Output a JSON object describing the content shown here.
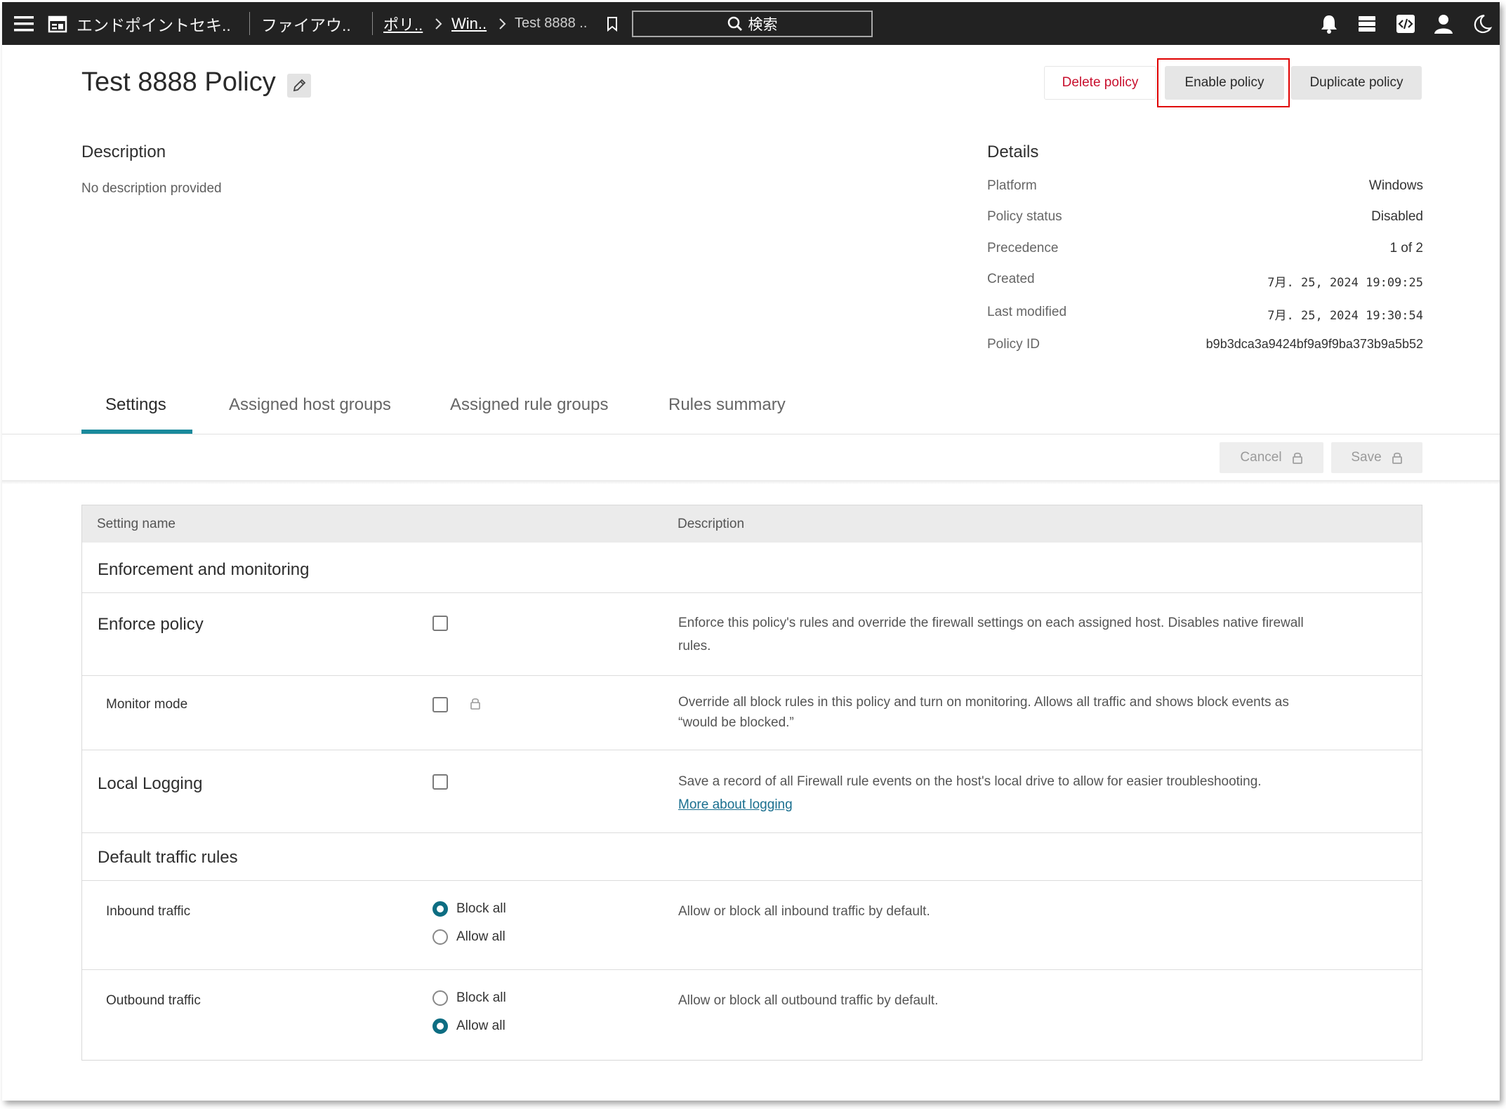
{
  "topbar": {
    "app_title": "エンドポイントセキ..",
    "section": "ファイアウ..",
    "breadcrumb_1": "ポリ..",
    "breadcrumb_2": "Win..",
    "breadcrumb_3": "Test 8888 ..",
    "search_placeholder": "検索",
    "icons": [
      "menu-icon",
      "app-icon",
      "chevron-right-icon",
      "bookmark-icon",
      "search-icon",
      "bell-icon",
      "stack-icon",
      "code-icon",
      "user-icon",
      "moon-icon"
    ]
  },
  "header": {
    "title": "Test 8888 Policy",
    "delete_label": "Delete policy",
    "enable_label": "Enable policy",
    "duplicate_label": "Duplicate policy"
  },
  "description": {
    "heading": "Description",
    "text": "No description provided"
  },
  "details": {
    "heading": "Details",
    "rows": [
      {
        "label": "Platform",
        "value": "Windows"
      },
      {
        "label": "Policy status",
        "value": "Disabled"
      },
      {
        "label": "Precedence",
        "value": "1 of 2"
      },
      {
        "label": "Created",
        "value": "7月. 25, 2024 19:09:25"
      },
      {
        "label": "Last modified",
        "value": "7月. 25, 2024 19:30:54"
      },
      {
        "label": "Policy ID",
        "value": "b9b3dca3a9424bf9a9f9ba373b9a5b52"
      }
    ]
  },
  "tabs": [
    {
      "label": "Settings",
      "active": true
    },
    {
      "label": "Assigned host groups",
      "active": false
    },
    {
      "label": "Assigned rule groups",
      "active": false
    },
    {
      "label": "Rules summary",
      "active": false
    }
  ],
  "toolbar": {
    "cancel_label": "Cancel",
    "save_label": "Save"
  },
  "table": {
    "col_setting": "Setting name",
    "col_description": "Description",
    "group_enforcement": "Enforcement and monitoring",
    "enforce_policy": {
      "name": "Enforce policy",
      "checked": false,
      "description": "Enforce this policy's rules and override the firewall settings on each assigned host. Disables native firewall rules."
    },
    "monitor_mode": {
      "name": "Monitor mode",
      "checked": false,
      "locked": true,
      "description": "Override all block rules in this policy and turn on monitoring. Allows all traffic and shows block events as “would be blocked.”"
    },
    "local_logging": {
      "name": "Local Logging",
      "checked": false,
      "description": "Save a record of all Firewall rule events on the host's local drive to allow for easier troubleshooting.",
      "link": "More about logging"
    },
    "group_traffic": "Default traffic rules",
    "inbound": {
      "name": "Inbound traffic",
      "options": [
        "Block all",
        "Allow all"
      ],
      "selected": "Block all",
      "description": "Allow or block all inbound traffic by default."
    },
    "outbound": {
      "name": "Outbound traffic",
      "options": [
        "Block all",
        "Allow all"
      ],
      "selected": "Allow all",
      "description": "Allow or block all outbound traffic by default."
    }
  },
  "colors": {
    "topbar": "#222222",
    "accent": "#1a8a9c",
    "radio_selected": "#0d6d82",
    "danger": "#c8102e",
    "highlight": "#e00000"
  }
}
